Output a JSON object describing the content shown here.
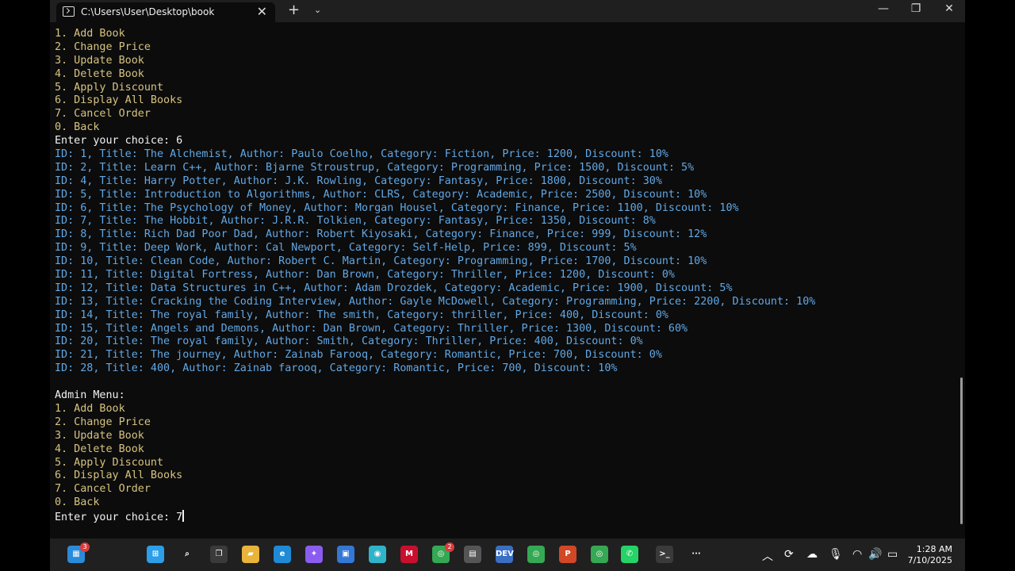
{
  "window": {
    "tab_title": "C:\\Users\\User\\Desktop\\book",
    "tab_close": "✕",
    "new_tab": "+",
    "dropdown": "⌄",
    "minimize": "—",
    "restore": "❐",
    "close": "✕"
  },
  "terminal": {
    "lines": [
      {
        "text": "1. Add Book",
        "style": "menu"
      },
      {
        "text": "2. Change Price",
        "style": "menu"
      },
      {
        "text": "3. Update Book",
        "style": "menu"
      },
      {
        "text": "4. Delete Book",
        "style": "menu"
      },
      {
        "text": "5. Apply Discount",
        "style": "menu"
      },
      {
        "text": "6. Display All Books",
        "style": "menu"
      },
      {
        "text": "7. Cancel Order",
        "style": "menu"
      },
      {
        "text": "0. Back",
        "style": "menu"
      },
      {
        "text": "Enter your choice: 6",
        "style": "white"
      },
      {
        "text": "ID: 1, Title: The Alchemist, Author: Paulo Coelho, Category: Fiction, Price: 1200, Discount: 10%",
        "style": "book"
      },
      {
        "text": "ID: 2, Title: Learn C++, Author: Bjarne Stroustrup, Category: Programming, Price: 1500, Discount: 5%",
        "style": "book"
      },
      {
        "text": "ID: 4, Title: Harry Potter, Author: J.K. Rowling, Category: Fantasy, Price: 1800, Discount: 30%",
        "style": "book"
      },
      {
        "text": "ID: 5, Title: Introduction to Algorithms, Author: CLRS, Category: Academic, Price: 2500, Discount: 10%",
        "style": "book"
      },
      {
        "text": "ID: 6, Title: The Psychology of Money, Author: Morgan Housel, Category: Finance, Price: 1100, Discount: 10%",
        "style": "book"
      },
      {
        "text": "ID: 7, Title: The Hobbit, Author: J.R.R. Tolkien, Category: Fantasy, Price: 1350, Discount: 8%",
        "style": "book"
      },
      {
        "text": "ID: 8, Title: Rich Dad Poor Dad, Author: Robert Kiyosaki, Category: Finance, Price: 999, Discount: 12%",
        "style": "book"
      },
      {
        "text": "ID: 9, Title: Deep Work, Author: Cal Newport, Category: Self-Help, Price: 899, Discount: 5%",
        "style": "book"
      },
      {
        "text": "ID: 10, Title: Clean Code, Author: Robert C. Martin, Category: Programming, Price: 1700, Discount: 10%",
        "style": "book"
      },
      {
        "text": "ID: 11, Title: Digital Fortress, Author: Dan Brown, Category: Thriller, Price: 1200, Discount: 0%",
        "style": "book"
      },
      {
        "text": "ID: 12, Title: Data Structures in C++, Author: Adam Drozdek, Category: Academic, Price: 1900, Discount: 5%",
        "style": "book"
      },
      {
        "text": "ID: 13, Title: Cracking the Coding Interview, Author: Gayle McDowell, Category: Programming, Price: 2200, Discount: 10%",
        "style": "book"
      },
      {
        "text": "ID: 14, Title: The royal family, Author: The smith, Category: thriller, Price: 400, Discount: 0%",
        "style": "book"
      },
      {
        "text": "ID: 15, Title: Angels and Demons, Author: Dan Brown, Category: Thriller, Price: 1300, Discount: 60%",
        "style": "book"
      },
      {
        "text": "ID: 20, Title: The royal family, Author: Smith, Category: Thriller, Price: 400, Discount: 0%",
        "style": "book"
      },
      {
        "text": "ID: 21, Title: The journey, Author: Zainab Farooq, Category: Romantic, Price: 700, Discount: 0%",
        "style": "book"
      },
      {
        "text": "ID: 28, Title: 400, Author: Zainab farooq, Category: Romantic, Price: 700, Discount: 10%",
        "style": "book"
      },
      {
        "text": "",
        "style": "white"
      },
      {
        "text": "Admin Menu:",
        "style": "white"
      },
      {
        "text": "1. Add Book",
        "style": "menu"
      },
      {
        "text": "2. Change Price",
        "style": "menu"
      },
      {
        "text": "3. Update Book",
        "style": "menu"
      },
      {
        "text": "4. Delete Book",
        "style": "menu"
      },
      {
        "text": "5. Apply Discount",
        "style": "menu"
      },
      {
        "text": "6. Display All Books",
        "style": "menu"
      },
      {
        "text": "7. Cancel Order",
        "style": "menu"
      },
      {
        "text": "0. Back",
        "style": "menu"
      }
    ],
    "prompt": "Enter your choice: 7"
  },
  "taskbar": {
    "icons": [
      {
        "name": "widgets-icon",
        "glyph": "▦",
        "color": "#2a8bd8",
        "badge": "3"
      },
      {
        "name": "start-icon",
        "glyph": "⊞",
        "color": "#2d9ee8"
      },
      {
        "name": "search-icon",
        "glyph": "⌕",
        "color": "#202020"
      },
      {
        "name": "task-view-icon",
        "glyph": "❐",
        "color": "#3a3a3a"
      },
      {
        "name": "file-explorer-icon",
        "glyph": "▰",
        "color": "#e8b43a"
      },
      {
        "name": "edge-icon",
        "glyph": "e",
        "color": "#1f8ad6"
      },
      {
        "name": "copilot-icon",
        "glyph": "✦",
        "color": "#8a5cf0"
      },
      {
        "name": "store-icon",
        "glyph": "▣",
        "color": "#3378d6"
      },
      {
        "name": "app-icon",
        "glyph": "◉",
        "color": "#2fb3c9"
      },
      {
        "name": "mcafee-icon",
        "glyph": "M",
        "color": "#c8102e"
      },
      {
        "name": "chrome-icon",
        "glyph": "◎",
        "color": "#34a853",
        "badge": "2"
      },
      {
        "name": "app-icon-2",
        "glyph": "▤",
        "color": "#555555"
      },
      {
        "name": "devcpp-icon",
        "glyph": "DEV",
        "color": "#3a6fc4"
      },
      {
        "name": "chrome-profile-icon",
        "glyph": "◎",
        "color": "#34a853"
      },
      {
        "name": "powerpoint-icon",
        "glyph": "P",
        "color": "#d24726"
      },
      {
        "name": "chrome-profile-icon-2",
        "glyph": "◎",
        "color": "#34a853"
      },
      {
        "name": "whatsapp-icon",
        "glyph": "✆",
        "color": "#25d366"
      },
      {
        "name": "terminal-icon",
        "glyph": ">_",
        "color": "#3a3a3a"
      },
      {
        "name": "more-icon",
        "glyph": "···",
        "color": "#202020"
      }
    ],
    "tray": [
      {
        "name": "chevron-up-icon",
        "glyph": "︿"
      },
      {
        "name": "sync-icon",
        "glyph": "⟳"
      },
      {
        "name": "cloud-icon",
        "glyph": "☁"
      },
      {
        "name": "microphone-icon",
        "glyph": "🎙"
      },
      {
        "name": "wifi-icon",
        "glyph": "◠"
      },
      {
        "name": "volume-icon",
        "glyph": "🔊"
      },
      {
        "name": "battery-icon",
        "glyph": "▭"
      }
    ],
    "time": "1:28 AM",
    "date": "7/10/2025"
  }
}
